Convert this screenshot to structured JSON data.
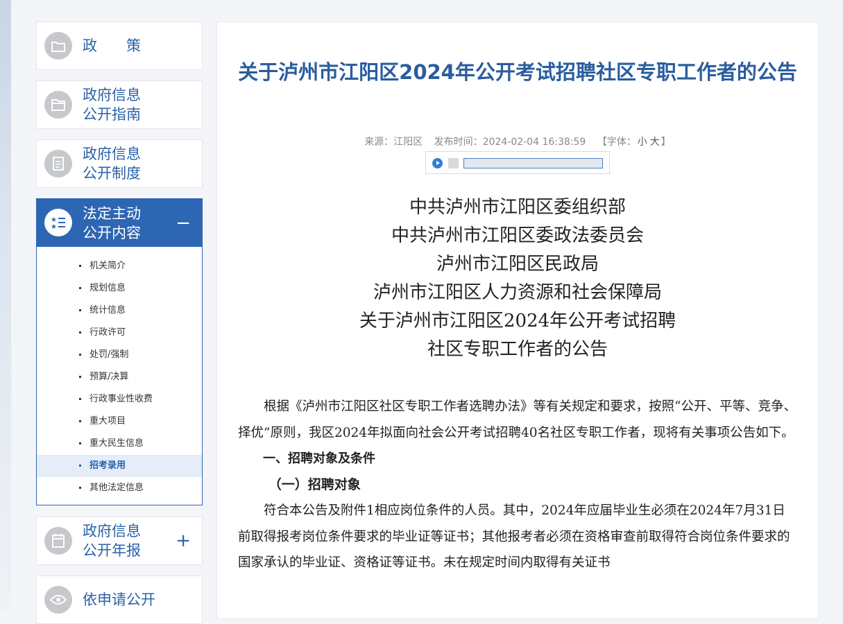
{
  "sidebar": {
    "items": [
      {
        "label": "政　　策",
        "toggle": ""
      },
      {
        "label": "政府信息\n公开指南",
        "toggle": ""
      },
      {
        "label": "政府信息\n公开制度",
        "toggle": ""
      },
      {
        "label": "法定主动\n公开内容",
        "toggle": "−"
      },
      {
        "label": "政府信息\n公开年报",
        "toggle": "+"
      },
      {
        "label": "依申请公开",
        "toggle": ""
      }
    ],
    "submenu": [
      "机关简介",
      "规划信息",
      "统计信息",
      "行政许可",
      "处罚/强制",
      "预算/决算",
      "行政事业性收费",
      "重大项目",
      "重大民生信息",
      "招考录用",
      "其他法定信息"
    ],
    "active_submenu": "招考录用"
  },
  "article": {
    "title": "关于泸州市江阳区2024年公开考试招聘社区专职工作者的公告",
    "source": "来源：江阳区",
    "published": "发布时间：2024-02-04 16:38:59",
    "font_size_prefix": "【字体：",
    "font_small": "小",
    "font_large": "大",
    "font_size_suffix": "】",
    "heading_lines": [
      "中共泸州市江阳区委组织部",
      "中共泸州市江阳区委政法委员会",
      "泸州市江阳区民政局",
      "泸州市江阳区人力资源和社会保障局",
      "关于泸州市江阳区2024年公开考试招聘",
      "社区专职工作者的公告"
    ],
    "paragraph1": "根据《泸州市江阳区社区专职工作者选聘办法》等有关规定和要求，按照“公开、平等、竞争、择优”原则，我区2024年拟面向社会公开考试招聘40名社区专职工作者，现将有关事项公告如下。",
    "section1": "一、招聘对象及条件",
    "subsection1": "（一）招聘对象",
    "paragraph2": "符合本公告及附件1相应岗位条件的人员。其中，2024年应届毕业生必须在2024年7月31日前取得报考岗位条件要求的毕业证等证书；其他报考者必须在资格审查前取得符合岗位条件要求的国家承认的毕业证、资格证等证书。未在规定时间内取得有关证书"
  }
}
